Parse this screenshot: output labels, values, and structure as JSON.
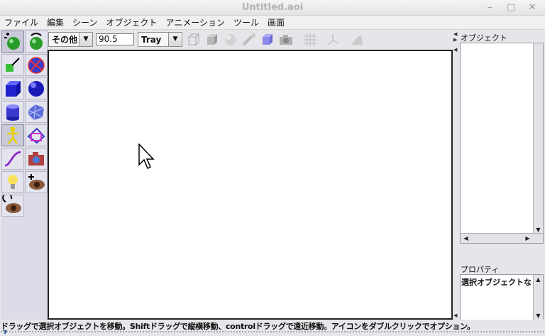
{
  "window": {
    "title": "Untitled.aoi"
  },
  "menu": [
    "ファイル",
    "編集",
    "シーン",
    "オブジェクト",
    "アニメーション",
    "ツール",
    "画面"
  ],
  "tools": [
    "move-tool-icon",
    "rotate-tool-icon",
    "scale-tool-icon",
    "skew-tool-icon",
    "cube-tool-icon",
    "sphere-tool-icon",
    "cylinder-tool-icon",
    "polymesh-tool-icon",
    "skeleton-tool-icon",
    "spline-tool-icon",
    "curve-tool-icon",
    "camera-tool-icon",
    "light-tool-icon",
    "move-view-icon",
    "rotate-view-icon"
  ],
  "viewbar": {
    "view_mode": "その他",
    "zoom_value": "90.5",
    "render_mode": "Tray"
  },
  "objects_panel": {
    "label": "オブジェクト"
  },
  "properties_panel": {
    "label": "プロパティ",
    "text": "選択オブジェクトなし"
  },
  "status": {
    "text": "ドラッグで選択オブジェクトを移動。Shiftドラッグで縦横移動、controlドラッグで遠近移動。アイコンをダブルクリックでオプション。"
  }
}
